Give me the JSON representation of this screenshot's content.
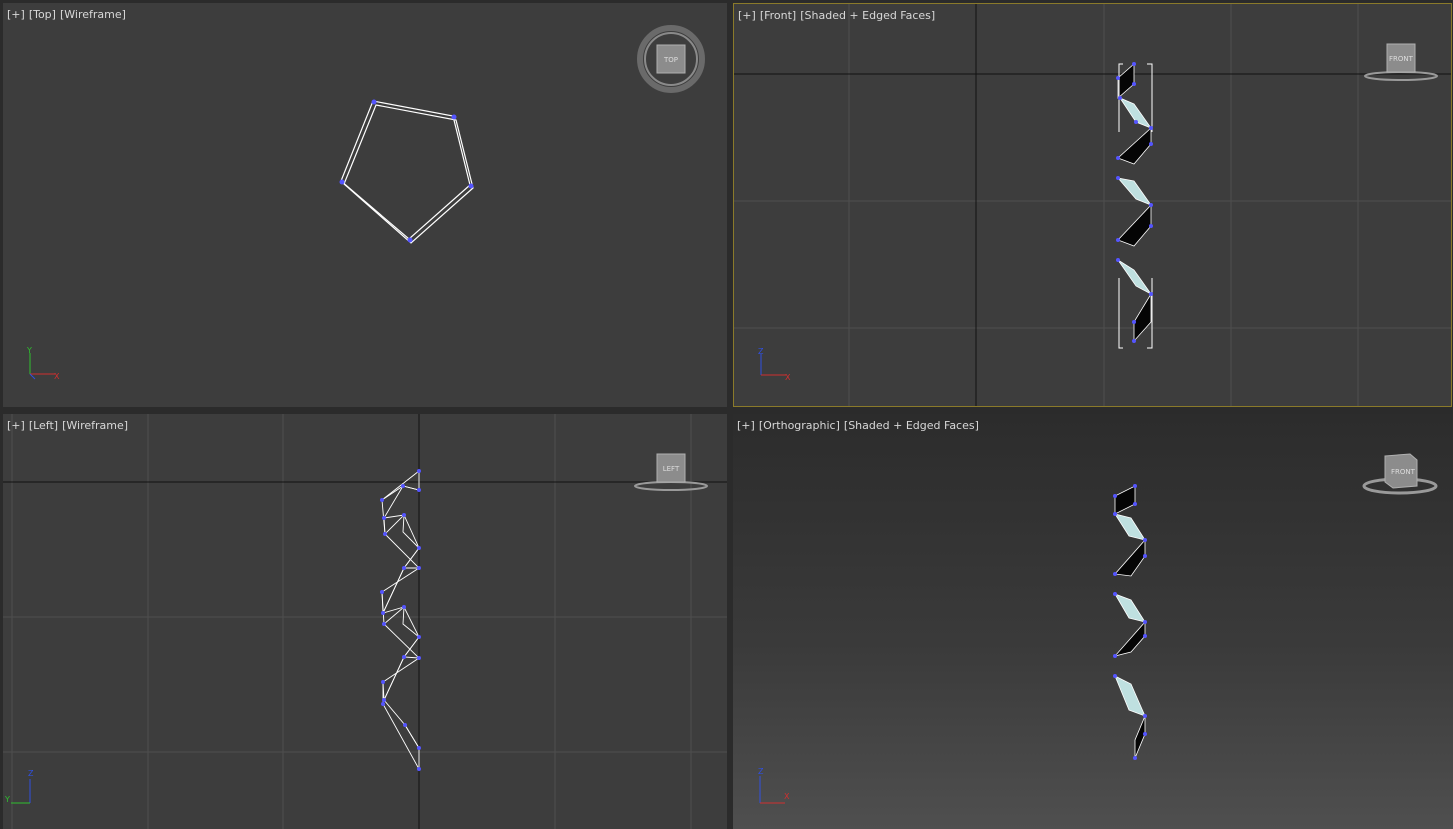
{
  "viewports": {
    "top": {
      "plus": "[+]",
      "view": "[Top]",
      "shading": "[Wireframe]"
    },
    "front": {
      "plus": "[+]",
      "view": "[Front]",
      "shading": "[Shaded + Edged Faces]"
    },
    "left": {
      "plus": "[+]",
      "view": "[Left]",
      "shading": "[Wireframe]"
    },
    "persp": {
      "plus": "[+]",
      "view": "[Orthographic]",
      "shading": "[Shaded + Edged Faces]"
    }
  },
  "viewcube": {
    "top": "TOP",
    "front": "FRONT",
    "left": "LEFT",
    "persp": "FRONT"
  },
  "axes": {
    "top": [
      "Y",
      "X"
    ],
    "front": [
      "Z",
      "X"
    ],
    "left": [
      "Z",
      "Y"
    ],
    "persp": [
      "Z",
      "X"
    ]
  },
  "colors": {
    "viewport_bg": "#3d3d3d",
    "active_border": "#8a7a2a",
    "grid_line": "#4f4f4f",
    "wire": "#ffffff",
    "vertex": "#5555ff",
    "ribbon_light": "#bfe0e0",
    "ribbon_dark": "#050505"
  }
}
